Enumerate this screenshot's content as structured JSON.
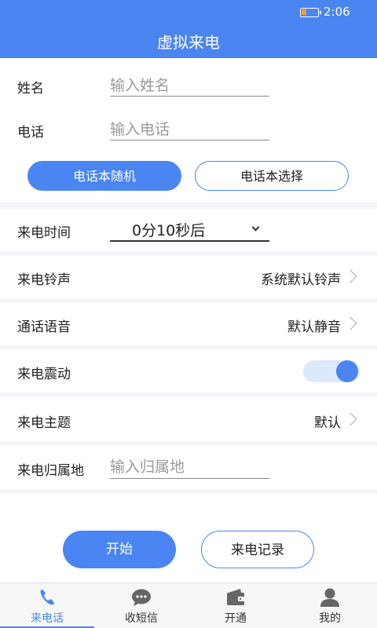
{
  "status_bar": {
    "time": "2:06"
  },
  "header": {
    "title": "虚拟来电"
  },
  "caller": {
    "name_label": "姓名",
    "name_placeholder": "输入姓名",
    "phone_label": "电话",
    "phone_placeholder": "输入电话",
    "random_button": "电话本随机",
    "select_button": "电话本选择"
  },
  "settings": {
    "time_label": "来电时间",
    "time_value": "0分10秒后",
    "ringtone_label": "来电铃声",
    "ringtone_value": "系统默认铃声",
    "voice_label": "通话语音",
    "voice_value": "默认静音",
    "vibrate_label": "来电震动",
    "vibrate_on": true,
    "theme_label": "来电主题",
    "theme_value": "默认",
    "location_label": "来电归属地",
    "location_placeholder": "输入归属地"
  },
  "actions": {
    "start": "开始",
    "records": "来电记录"
  },
  "tabs": [
    {
      "label": "来电话",
      "icon": "phone-icon",
      "active": true
    },
    {
      "label": "收短信",
      "icon": "chat-bubble-icon",
      "active": false
    },
    {
      "label": "开通",
      "icon": "wallet-icon",
      "active": false
    },
    {
      "label": "我的",
      "icon": "user-icon",
      "active": false
    }
  ],
  "colors": {
    "accent": "#4a85f1",
    "toggle_track": "#dce9fb",
    "background": "#f3f4f7"
  }
}
